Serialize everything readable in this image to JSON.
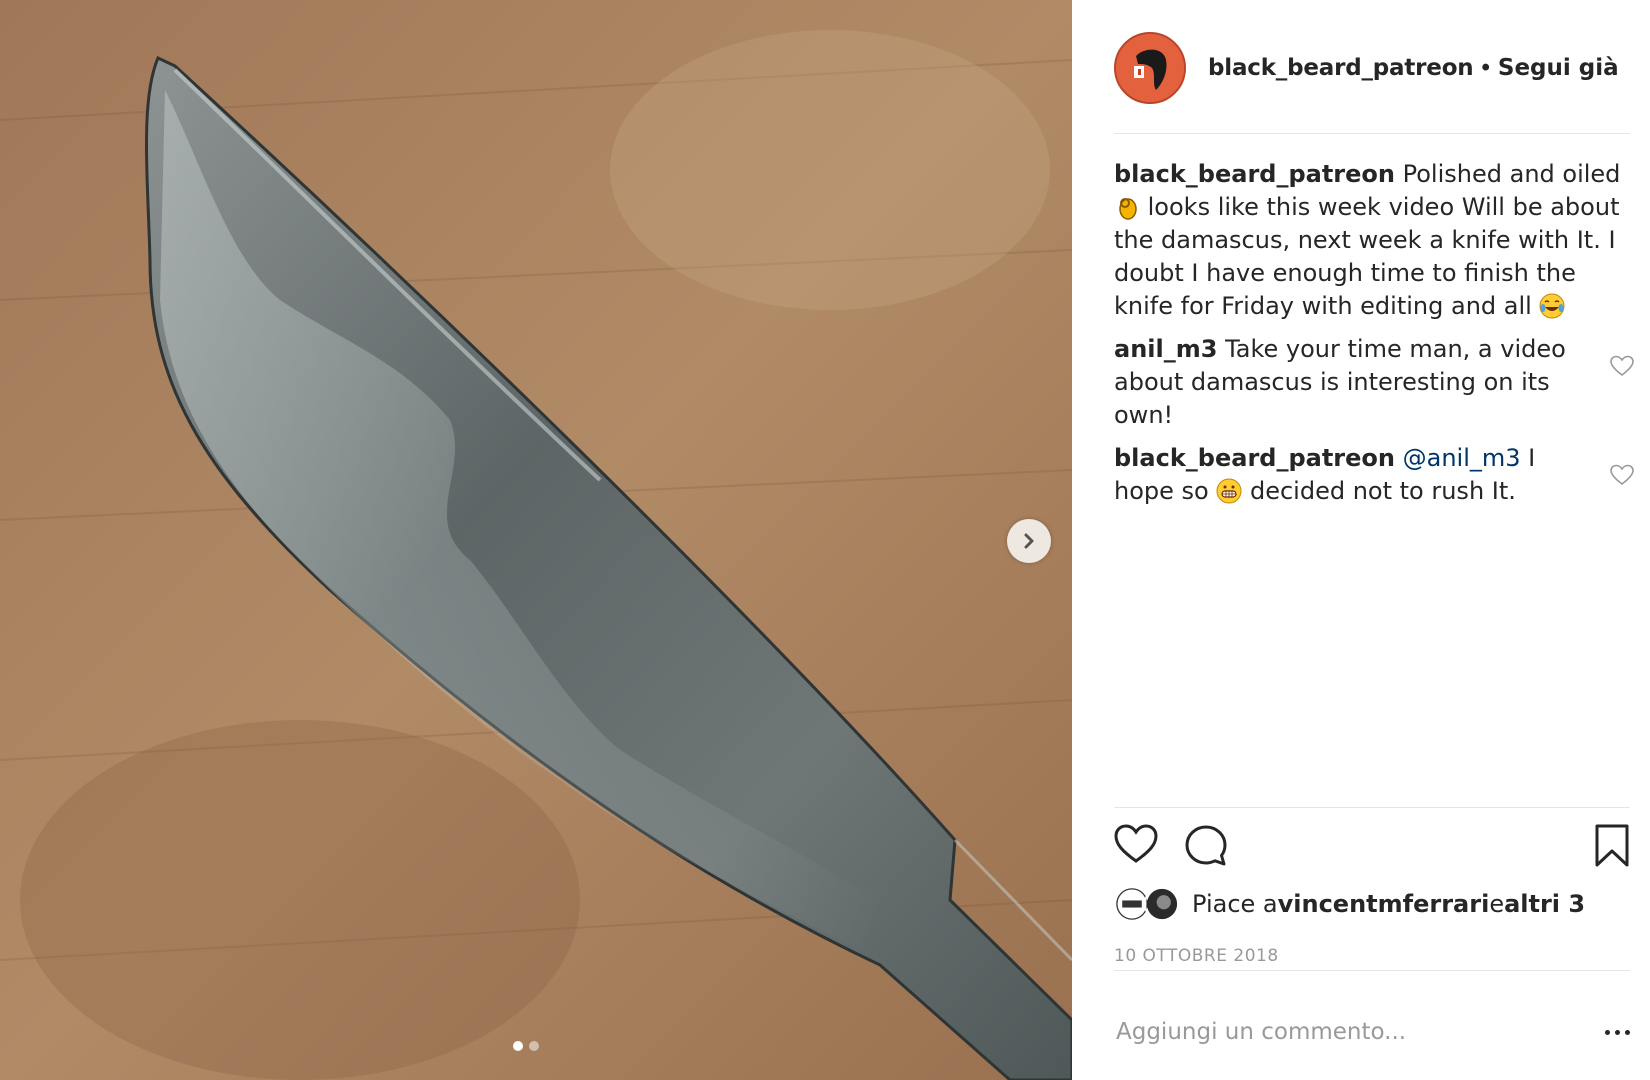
{
  "post": {
    "username": "black_beard_patreon",
    "separator": "•",
    "follow_status": "Segui già",
    "caption": {
      "user": "black_beard_patreon",
      "text_before_emoji": " Polished and oiled ",
      "text_after_emoji": " looks like this week video Will be about the damascus, next week a knife with It. I doubt I have enough time to finish the knife for Friday with editing and all ",
      "emoji_1": "ok-hand-emoji",
      "emoji_2": "tears-of-joy-emoji"
    },
    "comments": [
      {
        "user": "anil_m3",
        "text": " Take your time man, a video about damascus is interesting on its own!"
      },
      {
        "user": "black_beard_patreon",
        "mention": "@anil_m3",
        "text_before_emoji": " I hope so ",
        "text_after_emoji": " decided not to rush It.",
        "emoji": "grinning-emoji"
      }
    ],
    "likes": {
      "prefix": "Piace a ",
      "user": "vincentmferrari",
      "middle": " e ",
      "others": "altri 3"
    },
    "date": "10 OTTOBRE 2018",
    "add_comment_placeholder": "Aggiungi un commento...",
    "carousel": {
      "slide_count": 2,
      "active_index": 0
    },
    "colors": {
      "avatar_bg": "#e4613e",
      "mention": "#003569",
      "muted": "#999999"
    },
    "icons": [
      "chevron-right-icon",
      "heart-icon",
      "comment-icon",
      "bookmark-icon",
      "more-icon"
    ]
  }
}
